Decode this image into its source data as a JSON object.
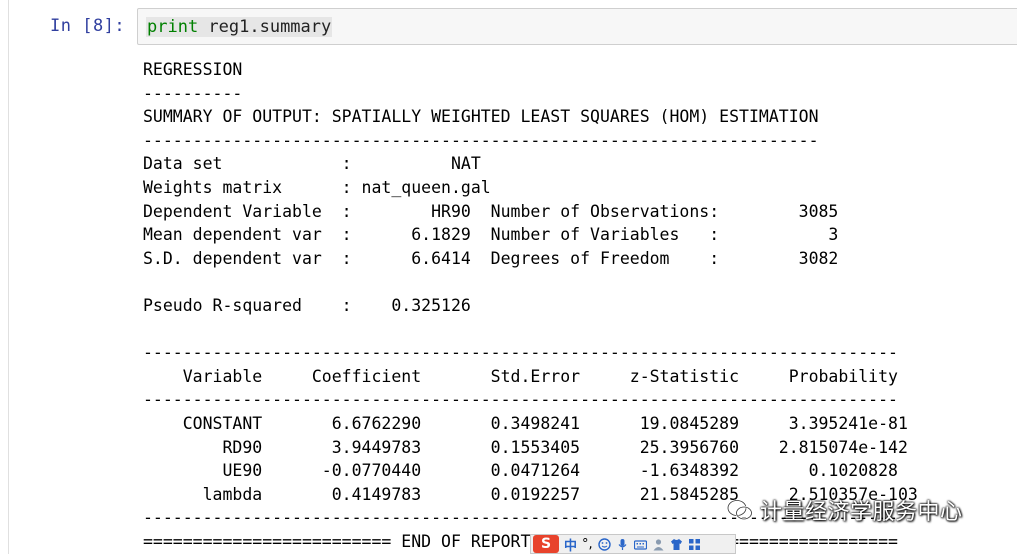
{
  "prompt": "In  [8]:",
  "code": {
    "keyword": "print",
    "rest": " reg1.summary"
  },
  "output_lines": [
    "REGRESSION",
    "----------",
    "SUMMARY OF OUTPUT: SPATIALLY WEIGHTED LEAST SQUARES (HOM) ESTIMATION",
    "--------------------------------------------------------------------",
    "Data set            :          NAT",
    "Weights matrix      : nat_queen.gal",
    "Dependent Variable  :        HR90  Number of Observations:        3085",
    "Mean dependent var  :      6.1829  Number of Variables   :           3",
    "S.D. dependent var  :      6.6414  Degrees of Freedom    :        3082",
    "",
    "Pseudo R-squared    :    0.325126",
    "",
    "----------------------------------------------------------------------------",
    "    Variable     Coefficient       Std.Error     z-Statistic     Probability",
    "----------------------------------------------------------------------------",
    "    CONSTANT       6.6762290       0.3498241      19.0845289     3.395241e-81",
    "        RD90       3.9449783       0.1553405      25.3956760    2.815074e-142",
    "        UE90      -0.0770440       0.0471264      -1.6348392       0.1020828",
    "      lambda       0.4149783       0.0192257      21.5845285     2.510357e-103",
    "----------------------------------------------------------------------------",
    "========================= END OF REPORT ===================================="
  ],
  "watermark": {
    "text": "计量经济学服务中心",
    "icon": "wechat-icon"
  },
  "ime_toolbar": {
    "logo": "S",
    "mode": "中",
    "punct": "°,",
    "icons": [
      "smiley-icon",
      "microphone-icon",
      "keyboard-icon",
      "user-icon",
      "shirt-icon",
      "grid-icon"
    ]
  }
}
